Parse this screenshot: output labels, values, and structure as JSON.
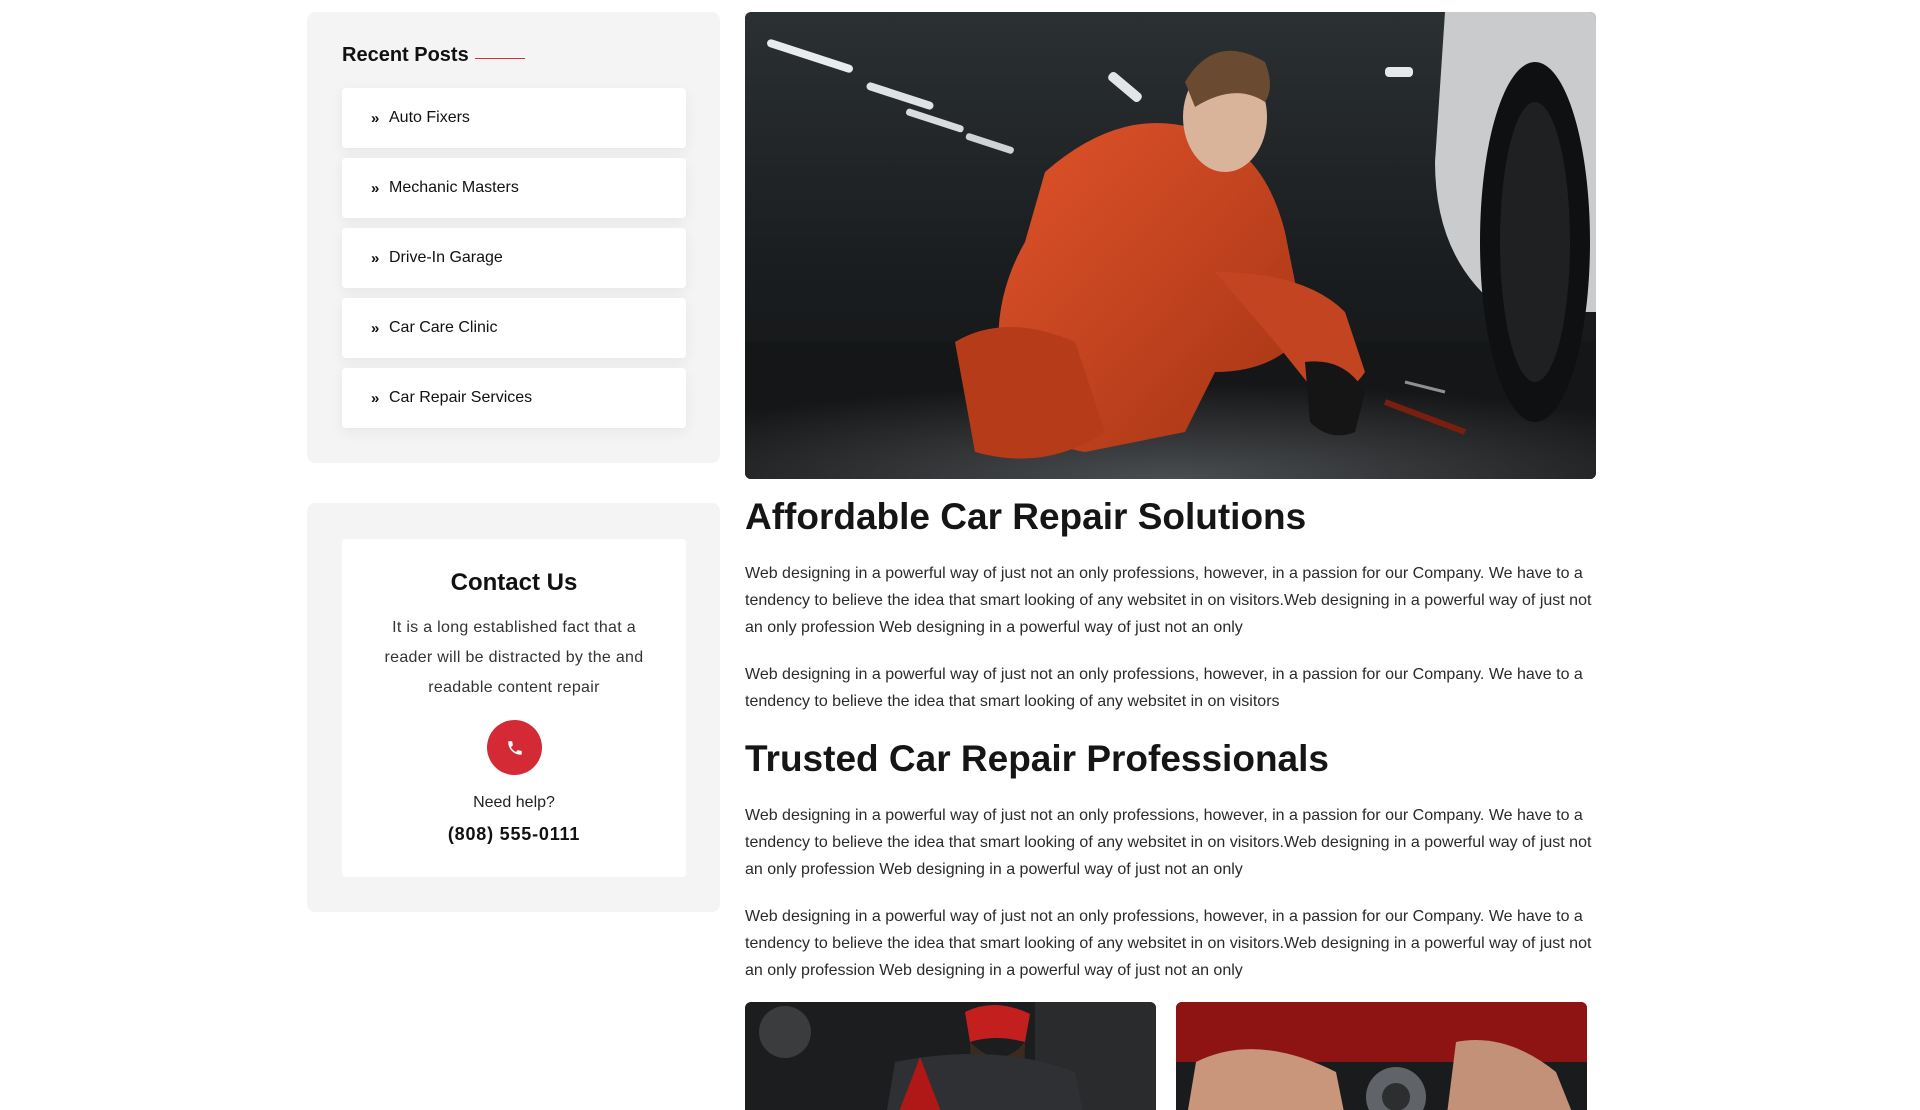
{
  "sidebar": {
    "recent_posts": {
      "title": "Recent Posts",
      "items": [
        {
          "label": "Auto Fixers",
          "icon": "double-chevron-right-icon"
        },
        {
          "label": "Mechanic Masters",
          "icon": "double-chevron-right-icon"
        },
        {
          "label": "Drive-In Garage",
          "icon": "double-chevron-right-icon"
        },
        {
          "label": "Car Care Clinic",
          "icon": "double-chevron-right-icon"
        },
        {
          "label": "Car Repair Services",
          "icon": "double-chevron-right-icon"
        }
      ]
    },
    "contact": {
      "title": "Contact Us",
      "description": "It is a long established fact that a reader will be distracted by the and readable content repair",
      "icon": "phone-icon",
      "need_help": "Need help?",
      "phone": "(808) 555-0111"
    }
  },
  "main": {
    "hero_image": "mechanic-in-orange-jumpsuit-photo",
    "sections": [
      {
        "heading": "Affordable Car Repair Solutions",
        "paragraphs": [
          "Web designing in a powerful way of just not an only professions, however, in a passion for our Company. We have to a tendency to believe the idea that smart looking of any websitet in on visitors.Web designing in a powerful way of just not an only profession Web designing in a powerful way of just not an only",
          "Web designing in a powerful way of just not an only professions, however, in a passion for our Company. We have to a tendency to believe the idea that smart looking of any websitet in on visitors"
        ]
      },
      {
        "heading": "Trusted Car Repair Professionals",
        "paragraphs": [
          "Web designing in a powerful way of just not an only professions, however, in a passion for our Company. We have to a tendency to believe the idea that smart looking of any websitet in on visitors.Web designing in a powerful way of just not an only profession Web designing in a powerful way of just not an only",
          "Web designing in a powerful way of just not an only professions, however, in a passion for our Company. We have to a tendency to believe the idea that smart looking of any websitet in on visitors.Web designing in a powerful way of just not an only profession Web designing in a powerful way of just not an only"
        ]
      }
    ],
    "gallery": [
      "mechanic-with-red-cap-photo",
      "hands-repairing-engine-photo"
    ]
  },
  "colors": {
    "accent": "#d42a35",
    "sidebar_bg": "#f4f4f4",
    "text": "#222222"
  }
}
